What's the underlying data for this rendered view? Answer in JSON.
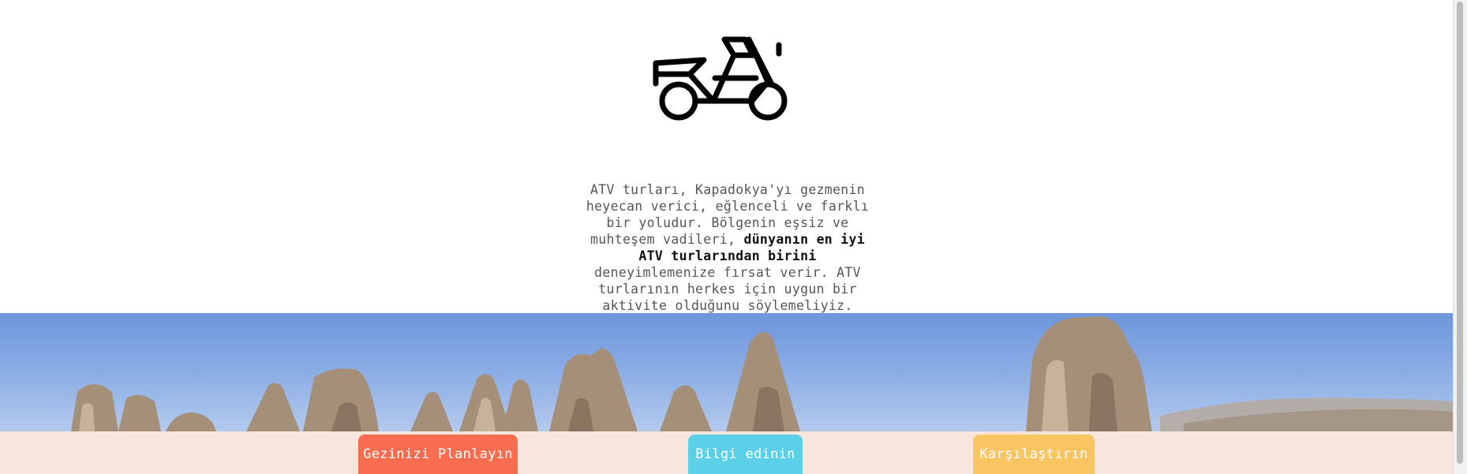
{
  "hero_icon": {
    "name": "atv-icon"
  },
  "intro": {
    "text_before": "ATV turları, Kapadokya'yı gezmenin heyecan verici, eğlenceli ve farklı bir yoludur. Bölgenin eşsiz ve muhteşem vadileri, ",
    "highlight": "dünyanın en iyi ATV turlarından birini",
    "text_after": " deneyimlemenize fırsat verir. ATV turlarının herkes için uygun bir aktivite olduğunu söylemeliyiz."
  },
  "hero_image": {
    "subject": "Kapadokya peri bacaları"
  },
  "cta": {
    "plan_label": "Gezinizi Planlayın",
    "info_label": "Bilgi edinin",
    "compare_label": "Karşılaştırın"
  },
  "colors": {
    "plan": "#f86c4f",
    "info": "#5bd0e6",
    "compare": "#f8c562",
    "cta_bar": "#f8e6dc"
  }
}
